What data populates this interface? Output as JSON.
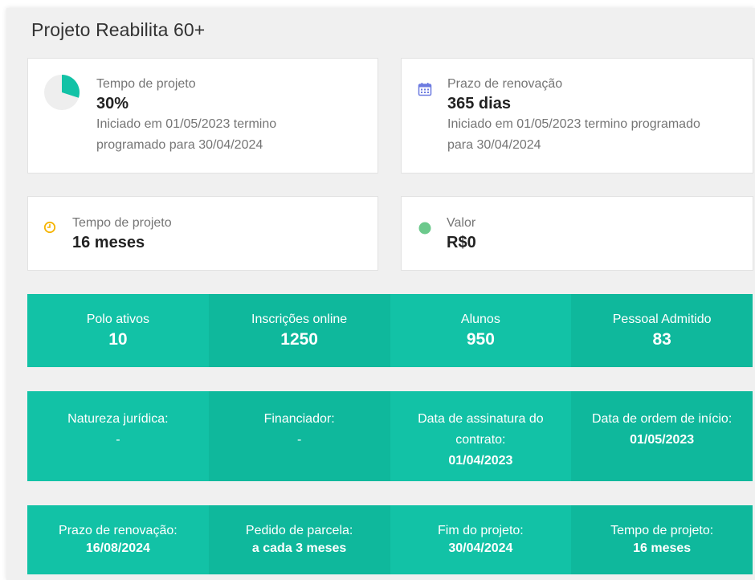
{
  "page": {
    "title": "Projeto Reabilita 60+"
  },
  "cards": [
    {
      "icon": "pie-progress-icon",
      "label": "Tempo de projeto",
      "value": "30%",
      "progress": 0.3,
      "sub_line1": "Iniciado em 01/05/2023 termino",
      "sub_line2": "programado para 30/04/2024",
      "accent": "#12c2a6"
    },
    {
      "icon": "calendar-icon",
      "label": "Prazo de renovação",
      "value": "365 dias",
      "sub_line1": "Iniciado em 01/05/2023 termino programado",
      "sub_line2": "para 30/04/2024",
      "accent": "#6c7ae0"
    },
    {
      "icon": "clock-icon",
      "label": "Tempo de projeto",
      "value": "16 meses",
      "accent": "#f5b400"
    },
    {
      "icon": "green-dot-icon",
      "label": "Valor",
      "value": "R$0",
      "accent": "#6cc98c"
    }
  ],
  "stats": [
    {
      "label": "Polo ativos",
      "value": "10"
    },
    {
      "label": "Inscrições online",
      "value": "1250"
    },
    {
      "label": "Alunos",
      "value": "950"
    },
    {
      "label": "Pessoal Admitido",
      "value": "83"
    }
  ],
  "details": [
    {
      "label": "Natureza jurídica:",
      "value": "-"
    },
    {
      "label": "Financiador:",
      "value": "-"
    },
    {
      "label": "Data de assinatura do contrato:",
      "value": "01/04/2023"
    },
    {
      "label": "Data de ordem de início:",
      "value": "01/05/2023"
    }
  ],
  "dates": [
    {
      "label": "Prazo de renovação:",
      "value": "16/08/2024"
    },
    {
      "label": "Pedido de parcela:",
      "value": "a cada 3 meses"
    },
    {
      "label": "Fim do projeto:",
      "value": "30/04/2024"
    },
    {
      "label": "Tempo de projeto:",
      "value": "16 meses"
    }
  ],
  "colors": {
    "teal_light": "#12c2a6",
    "teal_dark": "#0fb89c",
    "panel_bg": "#f0f0f0"
  }
}
